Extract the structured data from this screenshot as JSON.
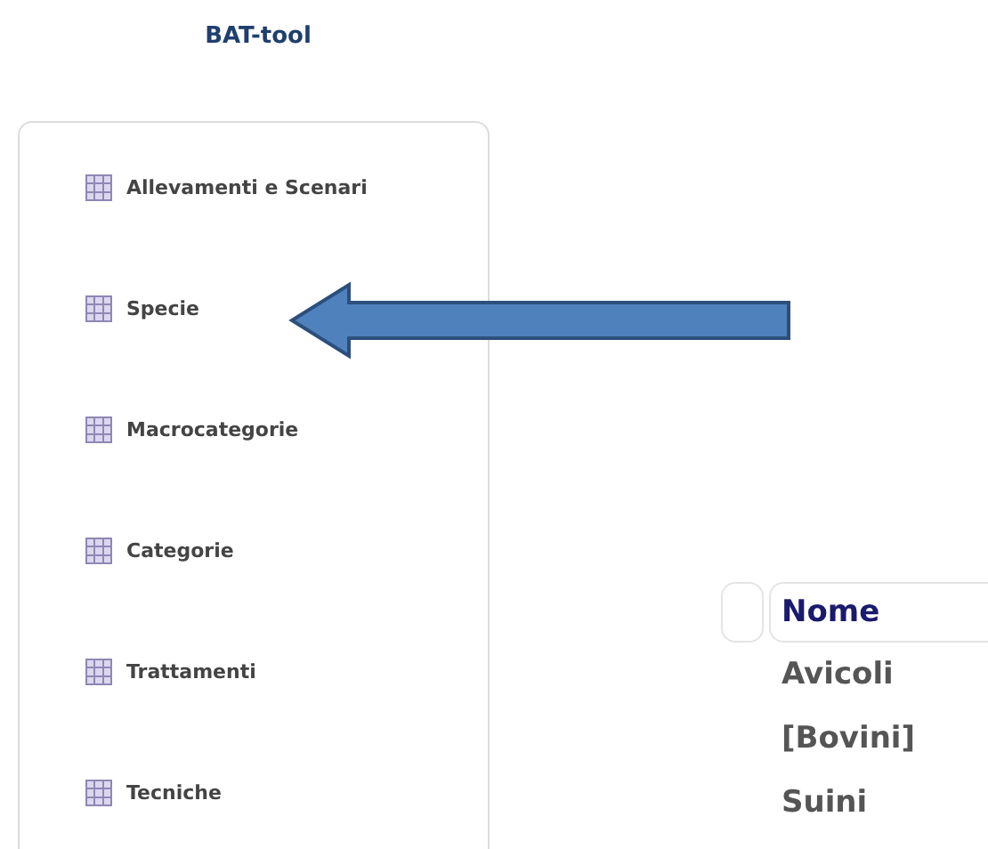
{
  "app_title": "BAT-tool",
  "sidebar": {
    "items": [
      {
        "label": "Allevamenti e Scenari"
      },
      {
        "label": "Specie"
      },
      {
        "label": "Macrocategorie"
      },
      {
        "label": "Categorie"
      },
      {
        "label": "Trattamenti"
      },
      {
        "label": "Tecniche"
      }
    ]
  },
  "table": {
    "columns": [
      "Nome"
    ],
    "rows": [
      {
        "cells": [
          "Avicoli"
        ]
      },
      {
        "cells": [
          "[Bovini]"
        ]
      },
      {
        "cells": [
          "Suini"
        ]
      }
    ]
  }
}
